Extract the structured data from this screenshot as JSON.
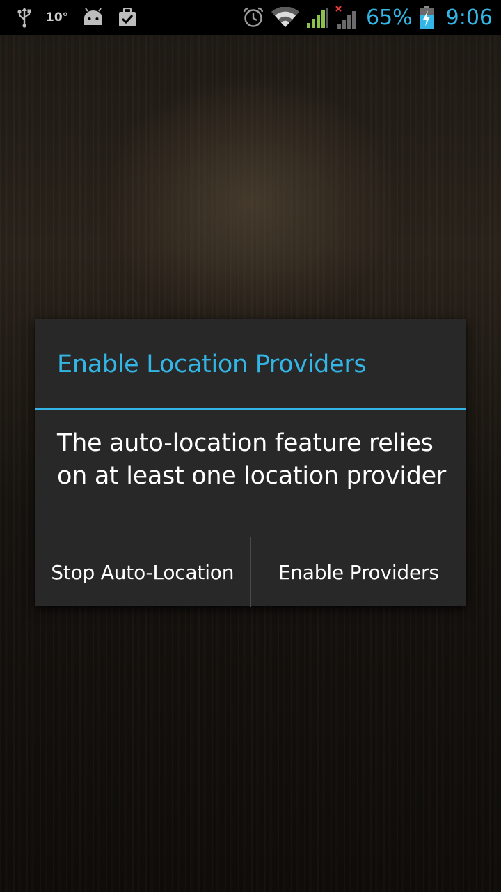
{
  "status_bar": {
    "left_icons": [
      "usb-icon",
      "weather-temp",
      "android-debug-icon",
      "clipboard-check-icon"
    ],
    "temperature": "10°",
    "right_icons": [
      "alarm-icon",
      "wifi-icon",
      "signal-icon",
      "signal-no-data-icon",
      "battery-charging-icon"
    ],
    "battery_percent": "65%",
    "time": "9:06",
    "accent_color": "#33b5e5"
  },
  "dialog": {
    "title": "Enable Location Providers",
    "message": "The auto-location feature relies on at least one location provider",
    "buttons": {
      "negative": "Stop Auto-Location",
      "positive": "Enable Providers"
    }
  }
}
